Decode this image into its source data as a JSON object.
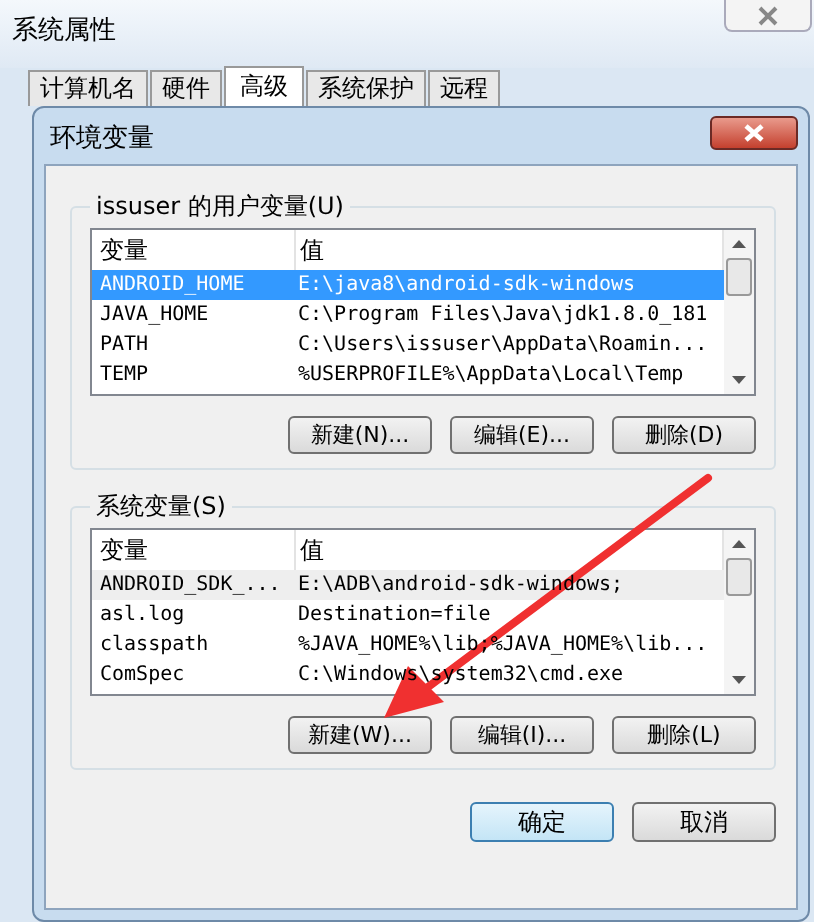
{
  "window": {
    "title": "系统属性"
  },
  "tabs": [
    {
      "label": "计算机名",
      "selected": false
    },
    {
      "label": "硬件",
      "selected": false
    },
    {
      "label": "高级",
      "selected": true
    },
    {
      "label": "系统保护",
      "selected": false
    },
    {
      "label": "远程",
      "selected": false
    }
  ],
  "dialog": {
    "title": "环境变量",
    "groups": [
      {
        "title": "issuser 的用户变量(U)",
        "focused": true,
        "columns": [
          "变量",
          "值"
        ],
        "rows": [
          {
            "name": "ANDROID_HOME",
            "value": "E:\\java8\\android-sdk-windows",
            "selected": true
          },
          {
            "name": "JAVA_HOME",
            "value": "C:\\Program Files\\Java\\jdk1.8.0_181",
            "selected": false
          },
          {
            "name": "PATH",
            "value": "C:\\Users\\issuser\\AppData\\Roamin...",
            "selected": false
          },
          {
            "name": "TEMP",
            "value": "%USERPROFILE%\\AppData\\Local\\Temp",
            "selected": false
          }
        ],
        "buttons": [
          "新建(N)...",
          "编辑(E)...",
          "删除(D)"
        ]
      },
      {
        "title": "系统变量(S)",
        "focused": false,
        "columns": [
          "变量",
          "值"
        ],
        "rows": [
          {
            "name": "ANDROID_SDK_...",
            "value": "E:\\ADB\\android-sdk-windows;",
            "selected": true
          },
          {
            "name": "asl.log",
            "value": "Destination=file",
            "selected": false
          },
          {
            "name": "classpath",
            "value": "%JAVA_HOME%\\lib;%JAVA_HOME%\\lib...",
            "selected": false
          },
          {
            "name": "ComSpec",
            "value": "C:\\Windows\\system32\\cmd.exe",
            "selected": false
          }
        ],
        "buttons": [
          "新建(W)...",
          "编辑(I)...",
          "删除(L)"
        ]
      }
    ],
    "buttons": [
      {
        "label": "确定",
        "default": true
      },
      {
        "label": "取消",
        "default": false
      }
    ]
  }
}
